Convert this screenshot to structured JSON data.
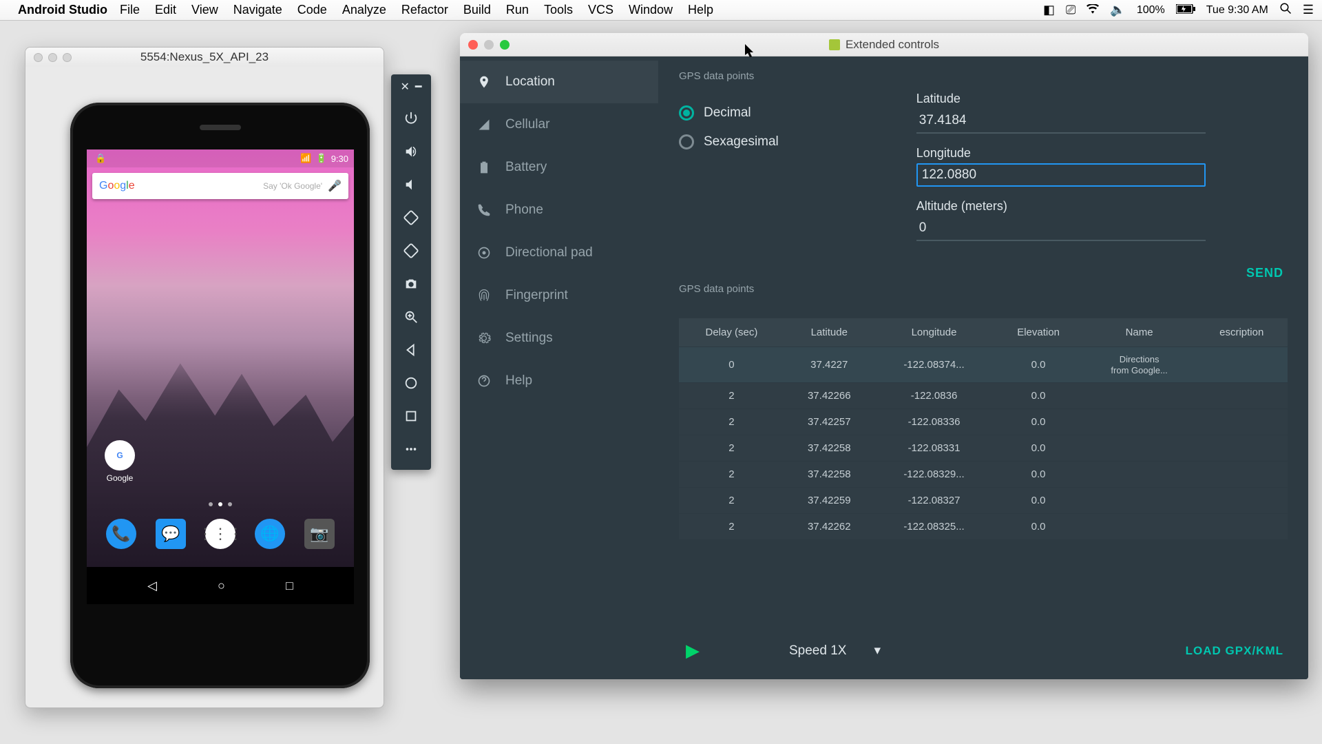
{
  "menubar": {
    "app": "Android Studio",
    "items": [
      "File",
      "Edit",
      "View",
      "Navigate",
      "Code",
      "Analyze",
      "Refactor",
      "Build",
      "Run",
      "Tools",
      "VCS",
      "Window",
      "Help"
    ],
    "battery": "100%",
    "time": "Tue 9:30 AM"
  },
  "emulator": {
    "title": "5554:Nexus_5X_API_23",
    "status_time": "9:30",
    "search_hint": "Say 'Ok Google'",
    "google_label": "Google"
  },
  "extended": {
    "window_title": "Extended controls",
    "sidebar": [
      {
        "label": "Location",
        "icon": "pin"
      },
      {
        "label": "Cellular",
        "icon": "signal"
      },
      {
        "label": "Battery",
        "icon": "battery"
      },
      {
        "label": "Phone",
        "icon": "phone"
      },
      {
        "label": "Directional pad",
        "icon": "dpad"
      },
      {
        "label": "Fingerprint",
        "icon": "fingerprint"
      },
      {
        "label": "Settings",
        "icon": "gear"
      },
      {
        "label": "Help",
        "icon": "help"
      }
    ],
    "gps_section_label": "GPS data points",
    "radio_decimal": "Decimal",
    "radio_sexagesimal": "Sexagesimal",
    "latitude_label": "Latitude",
    "latitude_value": "37.4184",
    "longitude_label": "Longitude",
    "longitude_value": "122.0880",
    "altitude_label": "Altitude (meters)",
    "altitude_value": "0",
    "send_label": "SEND",
    "table_section_label": "GPS data points",
    "table_headers": [
      "Delay (sec)",
      "Latitude",
      "Longitude",
      "Elevation",
      "Name",
      "escription"
    ],
    "table_rows": [
      {
        "delay": "0",
        "lat": "37.4227",
        "lon": "-122.08374...",
        "elev": "0.0",
        "name": "Directions from Google...",
        "desc": ""
      },
      {
        "delay": "2",
        "lat": "37.42266",
        "lon": "-122.0836",
        "elev": "0.0",
        "name": "",
        "desc": ""
      },
      {
        "delay": "2",
        "lat": "37.42257",
        "lon": "-122.08336",
        "elev": "0.0",
        "name": "",
        "desc": ""
      },
      {
        "delay": "2",
        "lat": "37.42258",
        "lon": "-122.08331",
        "elev": "0.0",
        "name": "",
        "desc": ""
      },
      {
        "delay": "2",
        "lat": "37.42258",
        "lon": "-122.08329...",
        "elev": "0.0",
        "name": "",
        "desc": ""
      },
      {
        "delay": "2",
        "lat": "37.42259",
        "lon": "-122.08327",
        "elev": "0.0",
        "name": "",
        "desc": ""
      },
      {
        "delay": "2",
        "lat": "37.42262",
        "lon": "-122.08325...",
        "elev": "0.0",
        "name": "",
        "desc": ""
      }
    ],
    "speed_label": "Speed 1X",
    "load_label": "LOAD GPX/KML"
  }
}
